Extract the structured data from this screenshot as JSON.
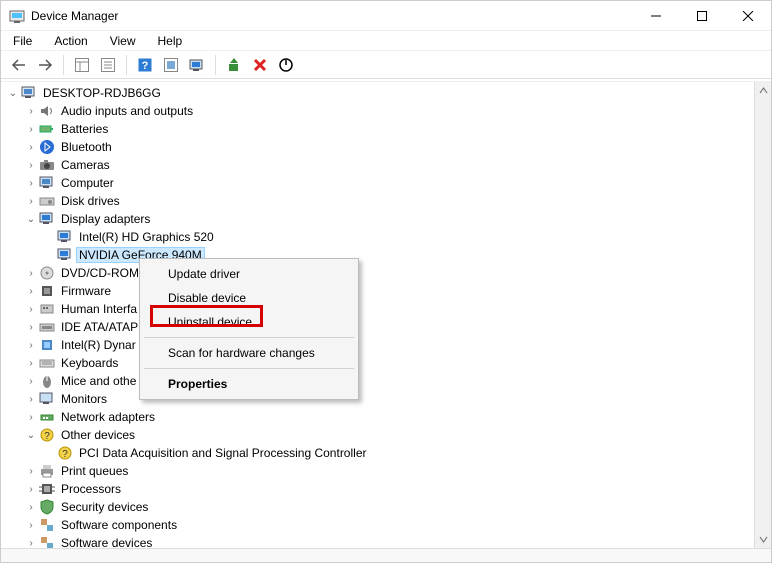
{
  "window": {
    "title": "Device Manager"
  },
  "menu": {
    "file": "File",
    "action": "Action",
    "view": "View",
    "help": "Help"
  },
  "tree": {
    "root": "DESKTOP-RDJB6GG",
    "items": [
      "Audio inputs and outputs",
      "Batteries",
      "Bluetooth",
      "Cameras",
      "Computer",
      "Disk drives",
      "Display adapters",
      "DVD/CD-ROM",
      "Firmware",
      "Human Interfa",
      "IDE ATA/ATAP",
      "Intel(R) Dynar",
      "Keyboards",
      "Mice and othe",
      "Monitors",
      "Network adapters",
      "Other devices",
      "Print queues",
      "Processors",
      "Security devices",
      "Software components",
      "Software devices"
    ],
    "display_children": [
      "Intel(R) HD Graphics 520",
      "NVIDIA GeForce 940M"
    ],
    "other_children": [
      "PCI Data Acquisition and Signal Processing Controller"
    ]
  },
  "context_menu": {
    "update": "Update driver",
    "disable": "Disable device",
    "uninstall": "Uninstall device",
    "scan": "Scan for hardware changes",
    "properties": "Properties"
  }
}
